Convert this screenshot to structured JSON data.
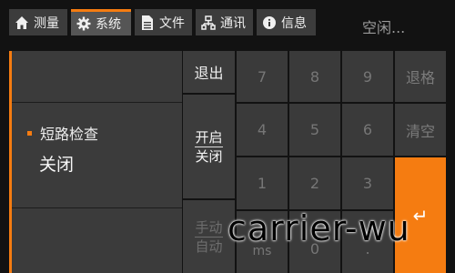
{
  "tabs": [
    {
      "label": "测量",
      "icon": "home-icon"
    },
    {
      "label": "系统",
      "icon": "gear-icon"
    },
    {
      "label": "文件",
      "icon": "document-icon"
    },
    {
      "label": "通讯",
      "icon": "network-icon"
    },
    {
      "label": "信息",
      "icon": "info-icon"
    }
  ],
  "status": "空闲...",
  "parameter": {
    "label": "短路检查",
    "value": "关闭"
  },
  "keys": {
    "exit": "退出",
    "toggle_top": {
      "on": "开启",
      "off": "关闭"
    },
    "toggle_bottom": {
      "on": "手动",
      "off": "自动"
    },
    "digits": [
      "7",
      "8",
      "9",
      "4",
      "5",
      "6",
      "1",
      "2",
      "3"
    ],
    "backspace": "退格",
    "clear": "清空",
    "enter": "↵",
    "row4_partial": [
      "ms",
      "0",
      "."
    ]
  },
  "watermark": "carrier-wu",
  "colors": {
    "accent": "#f57c11",
    "panel": "#3b3b3b",
    "background": "#131313"
  }
}
